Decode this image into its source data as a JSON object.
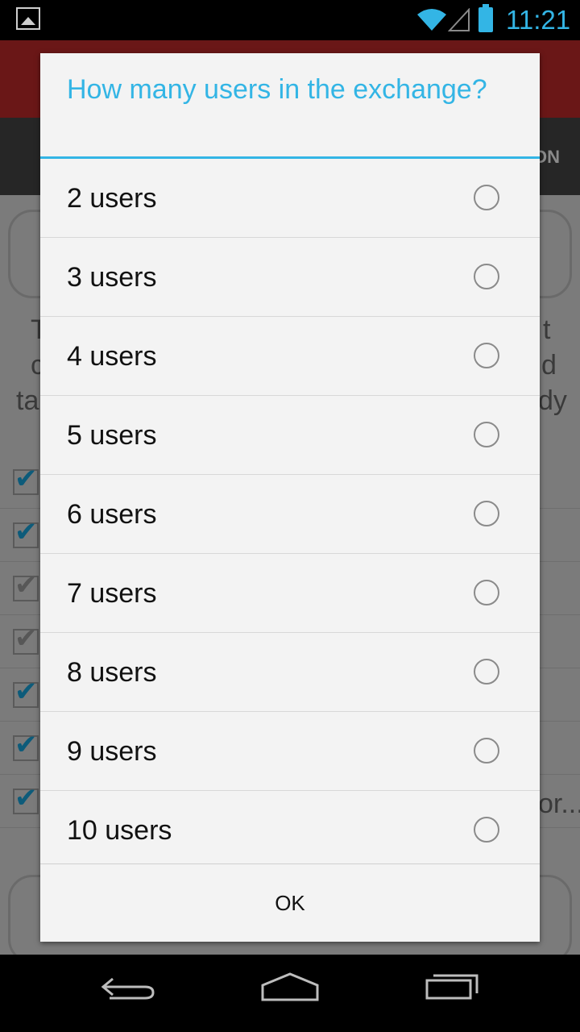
{
  "status_bar": {
    "time": "11:21"
  },
  "background_app": {
    "tab_fragment": "ON",
    "text_fragments_left": [
      "T",
      "c",
      "ta"
    ],
    "text_fragments_right": [
      "t",
      "d",
      "dy"
    ],
    "truncated_item": "or..."
  },
  "dialog": {
    "title": "How many users in the exchange?",
    "options": [
      {
        "label": "2 users"
      },
      {
        "label": "3 users"
      },
      {
        "label": "4 users"
      },
      {
        "label": "5 users"
      },
      {
        "label": "6 users"
      },
      {
        "label": "7 users"
      },
      {
        "label": "8 users"
      },
      {
        "label": "9 users"
      },
      {
        "label": "10 users"
      }
    ],
    "ok_label": "OK"
  },
  "colors": {
    "accent": "#33b5e5"
  }
}
